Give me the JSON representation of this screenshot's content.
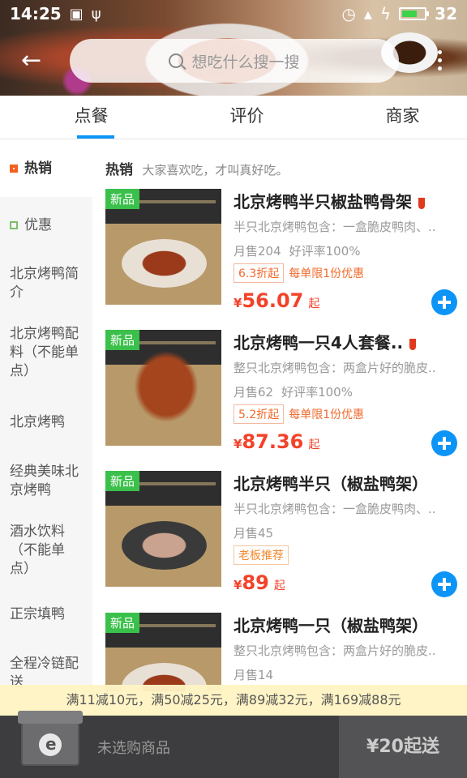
{
  "status": {
    "time": "14:25",
    "battery": "32",
    "battery_level": 0.7
  },
  "search": {
    "placeholder": "想吃什么搜一搜"
  },
  "tabs": [
    {
      "label": "点餐"
    },
    {
      "label": "评价"
    },
    {
      "label": "商家"
    }
  ],
  "sidebar": {
    "items": [
      {
        "label": "热销"
      },
      {
        "label": "优惠"
      },
      {
        "label": "北京烤鸭简介"
      },
      {
        "label": "北京烤鸭配料（不能单点）"
      },
      {
        "label": "北京烤鸭"
      },
      {
        "label": "经典美味北京烤鸭"
      },
      {
        "label": "酒水饮料（不能单点）"
      },
      {
        "label": "正宗填鸭"
      },
      {
        "label": "全程冷链配送"
      }
    ]
  },
  "section": {
    "title": "热销",
    "subtitle": "大家喜欢吃，才叫真好吃。"
  },
  "items": [
    {
      "tag": "新品",
      "name": "北京烤鸭半只椒盐鸭骨架",
      "desc": "半只北京烤鸭包含：一盒脆皮鸭肉、..",
      "sales": "月售204",
      "rating": "好评率100%",
      "discount": "6.3折起",
      "limit": "每单限1份优惠",
      "price_symbol": "¥",
      "price": "56.07",
      "from": "起"
    },
    {
      "tag": "新品",
      "name": "北京烤鸭一只4人套餐..",
      "desc": "整只北京烤鸭包含：两盒片好的脆皮..",
      "sales": "月售62",
      "rating": "好评率100%",
      "discount": "5.2折起",
      "limit": "每单限1份优惠",
      "price_symbol": "¥",
      "price": "87.36",
      "from": "起"
    },
    {
      "tag": "新品",
      "name": "北京烤鸭半只（椒盐鸭架）",
      "desc": "半只北京烤鸭包含：一盒脆皮鸭肉、..",
      "sales": "月售45",
      "badge": "老板推荐",
      "price_symbol": "¥",
      "price": "89",
      "from": "起"
    },
    {
      "tag": "新品",
      "name": "北京烤鸭一只（椒盐鸭架）",
      "desc": "整只北京烤鸭包含：两盒片好的脆皮..",
      "sales": "月售14"
    }
  ],
  "promo_bar": "满11减10元，满50减25元，满89减32元，满169减88元",
  "cart": {
    "empty_text": "未选购商品",
    "checkout": "¥20起送"
  }
}
